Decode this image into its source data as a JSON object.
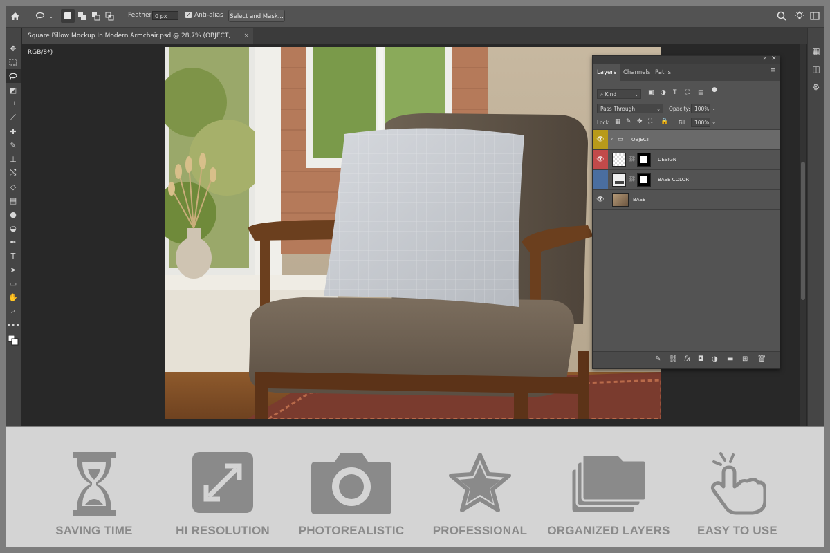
{
  "options_bar": {
    "feather_label": "Feather:",
    "feather_value": "0 px",
    "anti_alias_label": "Anti-alias",
    "select_mask_label": "Select and Mask..."
  },
  "document": {
    "tab_title": "Square Pillow Mockup In Modern Armchair.psd @ 28,7% (OBJECT, RGB/8*)"
  },
  "layers_panel": {
    "tabs": [
      "Layers",
      "Channels",
      "Paths"
    ],
    "kind_label": "Kind",
    "blend_mode": "Pass Through",
    "opacity_label": "Opacity:",
    "opacity_value": "100%",
    "lock_label": "Lock:",
    "fill_label": "Fill:",
    "fill_value": "100%",
    "layers": [
      {
        "name": "OBJECT",
        "type": "group",
        "color": "#b89a1a",
        "visible": true
      },
      {
        "name": "DESIGN",
        "type": "smart",
        "color": "#c24a4a",
        "visible": true
      },
      {
        "name": "BASE COLOR",
        "type": "fill",
        "color": "#4a6ea0",
        "visible": false
      },
      {
        "name": "BASE",
        "type": "image",
        "color": "",
        "visible": true
      }
    ],
    "footer_fx": "fx"
  },
  "features": [
    {
      "label": "SAVING TIME",
      "icon": "hourglass-icon"
    },
    {
      "label": "HI RESOLUTION",
      "icon": "expand-icon"
    },
    {
      "label": "PHOTOREALISTIC",
      "icon": "camera-icon"
    },
    {
      "label": "PROFESSIONAL",
      "icon": "star-icon"
    },
    {
      "label": "ORGANIZED LAYERS",
      "icon": "layers-icon"
    },
    {
      "label": "EASY TO USE",
      "icon": "tap-hand-icon"
    }
  ],
  "colors": {
    "feature_icon": "#8a8a8a",
    "feature_bg": "#d4d4d4",
    "app_bg": "#282828",
    "panel_bg": "#535353"
  }
}
